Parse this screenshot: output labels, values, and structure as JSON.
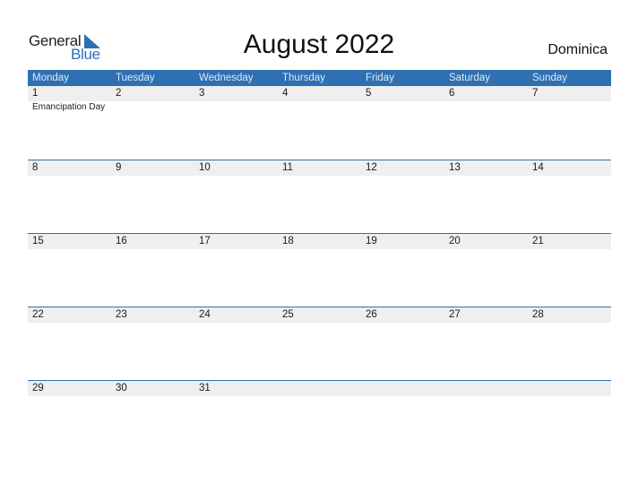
{
  "logo": {
    "word1": "General",
    "word2": "Blue"
  },
  "title": "August 2022",
  "country": "Dominica",
  "colors": {
    "accent": "#2e70b2",
    "date_strip": "#efefef"
  },
  "weekdays": [
    "Monday",
    "Tuesday",
    "Wednesday",
    "Thursday",
    "Friday",
    "Saturday",
    "Sunday"
  ],
  "weeks": [
    {
      "days": [
        "1",
        "2",
        "3",
        "4",
        "5",
        "6",
        "7"
      ],
      "events": [
        "Emancipation Day",
        "",
        "",
        "",
        "",
        "",
        ""
      ]
    },
    {
      "days": [
        "8",
        "9",
        "10",
        "11",
        "12",
        "13",
        "14"
      ],
      "events": [
        "",
        "",
        "",
        "",
        "",
        "",
        ""
      ]
    },
    {
      "days": [
        "15",
        "16",
        "17",
        "18",
        "19",
        "20",
        "21"
      ],
      "events": [
        "",
        "",
        "",
        "",
        "",
        "",
        ""
      ]
    },
    {
      "days": [
        "22",
        "23",
        "24",
        "25",
        "26",
        "27",
        "28"
      ],
      "events": [
        "",
        "",
        "",
        "",
        "",
        "",
        ""
      ]
    },
    {
      "days": [
        "29",
        "30",
        "31",
        "",
        "",
        "",
        ""
      ],
      "events": [
        "",
        "",
        "",
        "",
        "",
        "",
        ""
      ]
    }
  ]
}
